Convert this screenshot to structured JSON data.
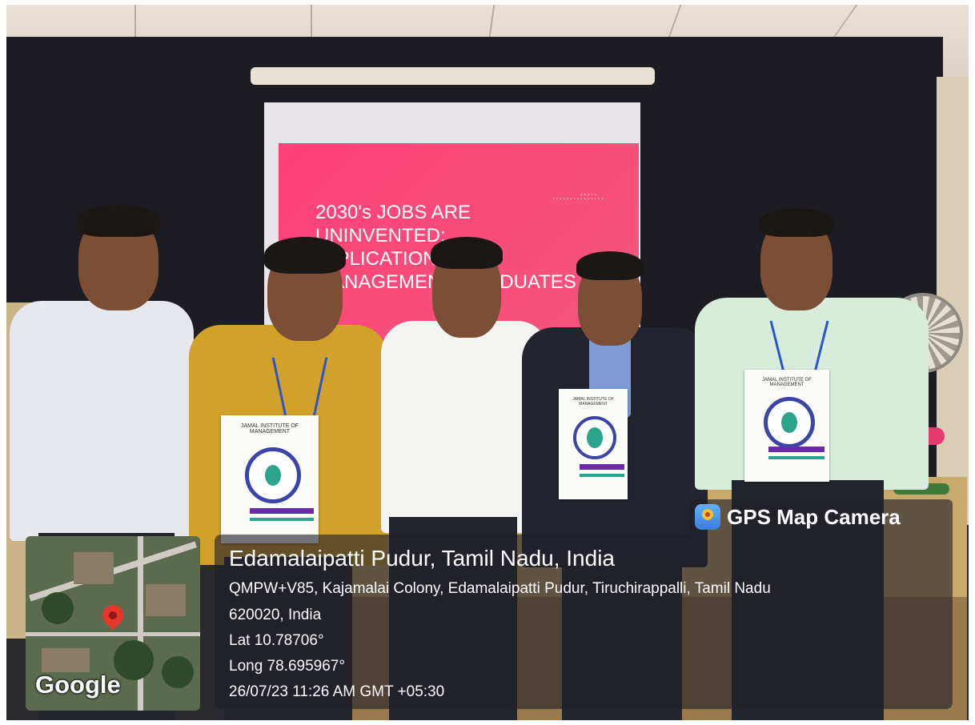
{
  "slide": {
    "title": "2030's JOBS ARE\nUNINVENTED:\nIMPLICATIONS FOR\nMANAGEMENT GRADUATES",
    "dots": "........:::::.."
  },
  "brochures": {
    "title": "JAMAL INSTITUTE OF MANAGEMENT"
  },
  "gps_badge": {
    "icon": "map-pin-icon",
    "label": "GPS Map Camera"
  },
  "location": {
    "place": "Edamalaipatti Pudur, Tamil Nadu, India",
    "address_line1": "QMPW+V85, Kajamalai Colony, Edamalaipatti Pudur, Tiruchirappalli, Tamil Nadu",
    "address_line2": "620020, India",
    "lat": "Lat 10.78706°",
    "long": "Long 78.695967°",
    "timestamp": "26/07/23 11:26 AM GMT +05:30"
  },
  "map": {
    "brand": "Google",
    "pin_color": "#e8362c"
  }
}
